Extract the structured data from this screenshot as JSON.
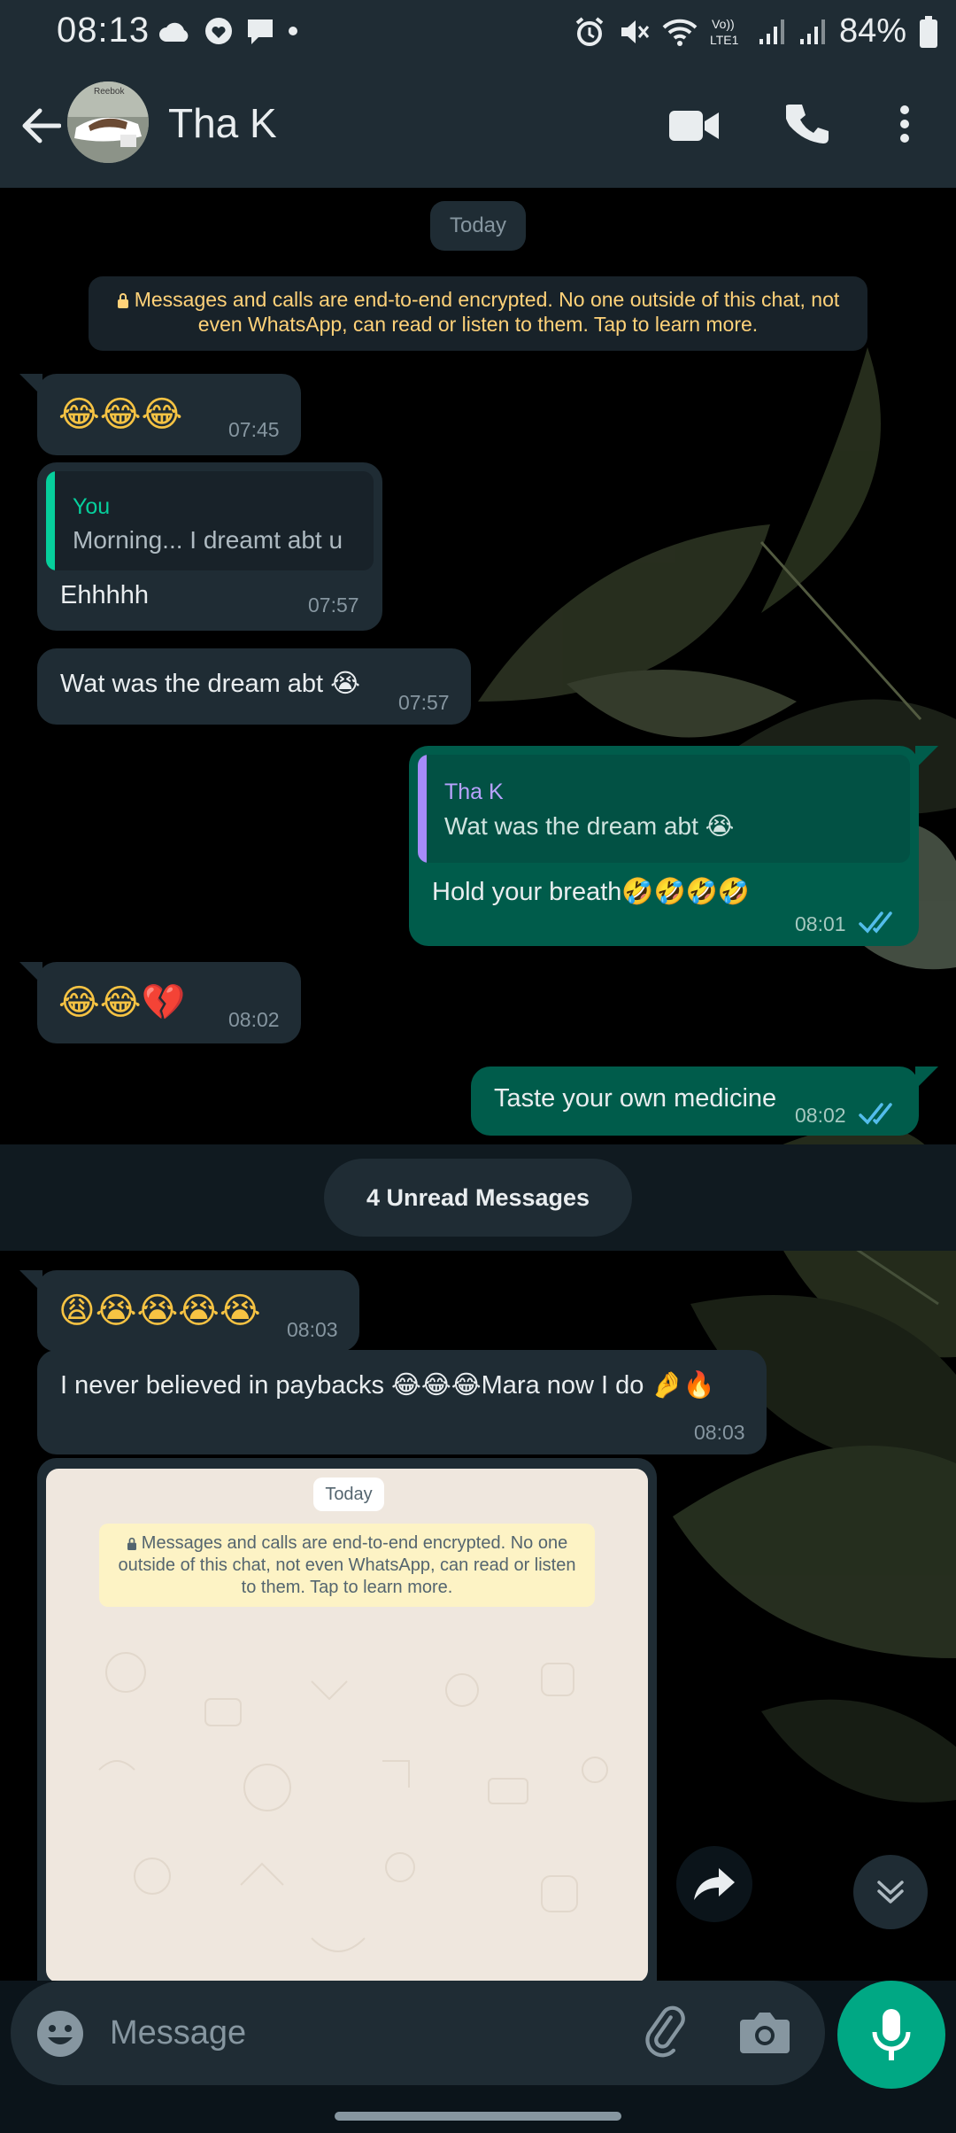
{
  "status_bar": {
    "time": "08:13",
    "battery": "84%"
  },
  "header": {
    "contact_name": "Tha K"
  },
  "chat": {
    "day_label": "Today",
    "encryption_notice": "Messages and calls are end-to-end encrypted. No one outside of this chat, not even WhatsApp, can read or listen to them. Tap to learn more.",
    "unread_label": "4 Unread Messages",
    "messages": [
      {
        "dir": "in",
        "text": "😂😂😂",
        "time": "07:45"
      },
      {
        "dir": "in",
        "quote_author": "You",
        "quote_text": "Morning... I dreamt abt u",
        "text": "Ehhhhh",
        "time": "07:57"
      },
      {
        "dir": "in",
        "text": "Wat was the dream abt 😭",
        "time": "07:57"
      },
      {
        "dir": "out",
        "quote_author": "Tha K",
        "quote_text": "Wat was the dream abt 😭",
        "text": "Hold your breath🤣🤣🤣🤣",
        "time": "08:01",
        "status": "read"
      },
      {
        "dir": "in",
        "text": "😂😂💔",
        "time": "08:02"
      },
      {
        "dir": "out",
        "text": "Taste your own medicine",
        "time": "08:02",
        "status": "read"
      },
      {
        "dir": "in",
        "text": "😩😭😭😭😭",
        "time": "08:03"
      },
      {
        "dir": "in",
        "text": "I never believed in paybacks 😂😂😂Mara now I do 🤌🔥",
        "time": "08:03"
      }
    ],
    "image_message": {
      "inner_day_label": "Today",
      "inner_encryption_notice": "Messages and calls are end-to-end encrypted. No one outside of this chat, not even WhatsApp, can read or listen to them. Tap to learn more."
    }
  },
  "composer": {
    "placeholder": "Message"
  },
  "colors": {
    "header_bg": "#1f2c34",
    "incoming_bubble": "#1f2c34",
    "outgoing_bubble": "#005c4b",
    "accent_green": "#00a884",
    "read_ticks": "#53bdeb",
    "notice_text": "#ffd279"
  },
  "icons": [
    "back-arrow-icon",
    "video-call-icon",
    "voice-call-icon",
    "more-options-icon",
    "lock-icon",
    "double-check-icon",
    "forward-icon",
    "double-chevron-down-icon",
    "emoji-icon",
    "paperclip-icon",
    "camera-icon",
    "microphone-icon"
  ]
}
